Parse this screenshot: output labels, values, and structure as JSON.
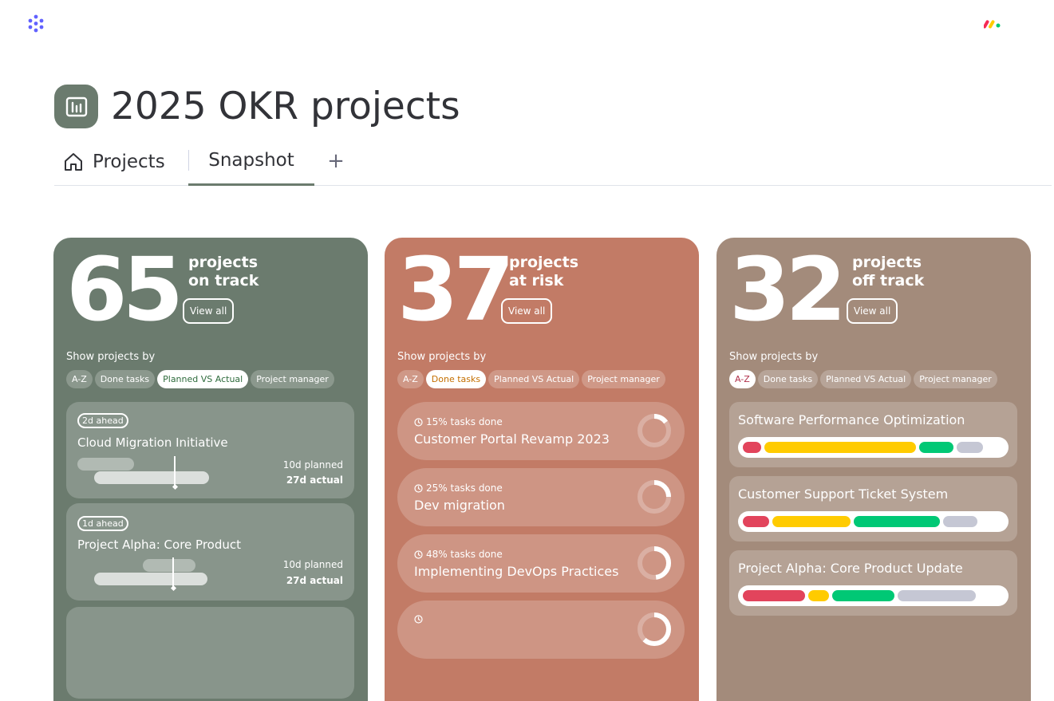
{
  "app": {
    "board_title": "2025 OKR projects",
    "icons": {
      "apps_logo": "dots-logo-icon",
      "brand_logo": "brand-logo-icon",
      "board": "chart-board-icon",
      "home": "home-icon",
      "add": "plus-icon",
      "clock": "clock-icon"
    }
  },
  "tabs": {
    "projects_label": "Projects",
    "snapshot_label": "Snapshot",
    "add_label": "+"
  },
  "colors": {
    "on_track": "#6b7b6e",
    "at_risk": "#c27b66",
    "off_track": "#a38b7b",
    "red": "#e2445c",
    "yellow": "#ffcb00",
    "green": "#00c875",
    "gray": "#c5c7d4"
  },
  "cards": {
    "on_track": {
      "count": "65",
      "label_line1": "projects",
      "label_line2": "on track",
      "view_all": "View all",
      "show_by": "Show projects by",
      "chips": [
        "A-Z",
        "Done tasks",
        "Planned VS Actual",
        "Project manager"
      ],
      "active_chip": "Planned VS Actual",
      "items": [
        {
          "badge": "2d ahead",
          "name": "Cloud Migration Initiative",
          "planned": "10d planned",
          "actual": "27d actual"
        },
        {
          "badge": "1d ahead",
          "name": "Project Alpha: Core Product",
          "planned": "10d planned",
          "actual": "27d actual"
        }
      ]
    },
    "at_risk": {
      "count": "37",
      "label_line1": "projects",
      "label_line2": "at risk",
      "view_all": "View all",
      "show_by": "Show projects by",
      "chips": [
        "A-Z",
        "Done tasks",
        "Planned VS Actual",
        "Project manager"
      ],
      "active_chip": "Done tasks",
      "items": [
        {
          "meta": "15% tasks done",
          "name": "Customer Portal Revamp 2023",
          "progress": 0.15
        },
        {
          "meta": "25% tasks done",
          "name": "Dev migration",
          "progress": 0.25
        },
        {
          "meta": "48% tasks done",
          "name": "Implementing DevOps Practices",
          "progress": 0.48
        },
        {
          "meta": "",
          "name": "",
          "progress": 0.62
        }
      ]
    },
    "off_track": {
      "count": "32",
      "label_line1": "projects",
      "label_line2": "off track",
      "view_all": "View all",
      "show_by": "Show projects by",
      "chips": [
        "A-Z",
        "Done tasks",
        "Planned VS Actual",
        "Project manager"
      ],
      "active_chip": "A-Z",
      "items": [
        {
          "name": "Software Performance Optimization",
          "segments": [
            {
              "color": "red",
              "share": 0.07
            },
            {
              "color": "yellow",
              "share": 0.58
            },
            {
              "color": "green",
              "share": 0.13
            },
            {
              "color": "gray",
              "share": 0.1
            }
          ]
        },
        {
          "name": "Customer Support Ticket System",
          "segments": [
            {
              "color": "red",
              "share": 0.1
            },
            {
              "color": "yellow",
              "share": 0.3
            },
            {
              "color": "green",
              "share": 0.33
            },
            {
              "color": "gray",
              "share": 0.13
            }
          ]
        },
        {
          "name": "Project Alpha: Core Product Update",
          "segments": [
            {
              "color": "red",
              "share": 0.24
            },
            {
              "color": "yellow",
              "share": 0.08
            },
            {
              "color": "green",
              "share": 0.24
            },
            {
              "color": "gray",
              "share": 0.3
            }
          ]
        }
      ]
    }
  }
}
